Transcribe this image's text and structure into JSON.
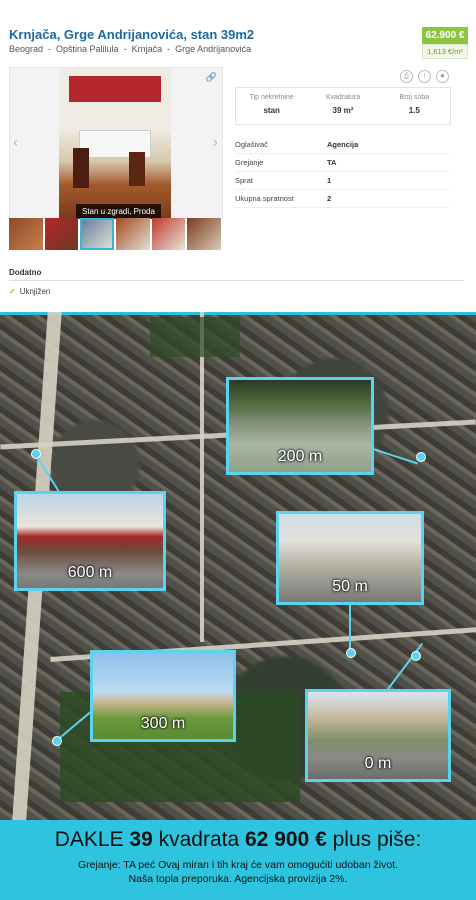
{
  "listing": {
    "title": "Krnjača, Grge Andrijanovića, stan 39m2",
    "breadcrumb": [
      "Beograd",
      "Opština Palilula",
      "Krnjača",
      "Grge Andrijanovića"
    ],
    "price": "62.900 €",
    "price_per_m2": "1.613 €/m²",
    "photo_caption": "Stan u zgradi, Proda",
    "specs": [
      {
        "label": "Tip nekretnine",
        "value": "stan"
      },
      {
        "label": "Kvadratura",
        "value": "39 m²"
      },
      {
        "label": "Broj soba",
        "value": "1.5"
      }
    ],
    "details": [
      {
        "label": "Oglašivač",
        "value": "Agencija"
      },
      {
        "label": "Grejanje",
        "value": "TA"
      },
      {
        "label": "Sprat",
        "value": "1"
      },
      {
        "label": "Ukupna spratnost",
        "value": "2"
      }
    ],
    "extra_heading": "Dodatno",
    "extra_items": [
      "Uknjižen"
    ]
  },
  "map": {
    "insets": [
      {
        "distance": "200 m"
      },
      {
        "distance": "600 m"
      },
      {
        "distance": "50 m"
      },
      {
        "distance": "300 m"
      },
      {
        "distance": "0 m"
      }
    ],
    "accent_color": "#5ad3ee"
  },
  "banner": {
    "lead": "DAKLE",
    "size_num": "39",
    "size_word": "kvadrata",
    "price": "62 900 €",
    "tail": "plus piše:",
    "line1": "Grejanje: TA peć Ovaj miran i tih kraj će vam omogućiti udoban život.",
    "line2": "Naša topla preporuka. Agencijska provizija 2%."
  }
}
